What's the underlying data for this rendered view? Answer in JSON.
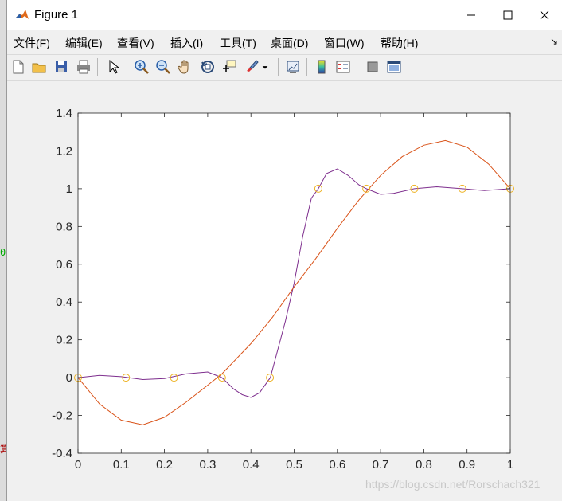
{
  "window": {
    "title": "Figure 1",
    "controls": {
      "minimize": "—",
      "maximize": "☐",
      "close": "✕"
    }
  },
  "menu": {
    "items": [
      "文件(F)",
      "编辑(E)",
      "查看(V)",
      "插入(I)",
      "工具(T)",
      "桌面(D)",
      "窗口(W)",
      "帮助(H)"
    ],
    "dock_glyph": "↘"
  },
  "toolbar": {
    "buttons": [
      "new-figure-icon",
      "open-file-icon",
      "save-icon",
      "print-icon",
      "select-arrow-icon",
      "zoom-in-icon",
      "zoom-out-icon",
      "pan-hand-icon",
      "rotate-3d-icon",
      "data-cursor-icon",
      "brush-icon",
      "brush-dropdown-icon",
      "link-plot-icon",
      "colorbar-icon",
      "legend-icon",
      "hide-plot-tools-icon",
      "show-plot-tools-icon"
    ]
  },
  "watermark": "https://blog.csdn.net/Rorschach321",
  "colors": {
    "purple": "#7e2f8e",
    "orange": "#d95319",
    "markers": "#edb120"
  },
  "chart_data": {
    "type": "line",
    "title": "",
    "xlabel": "",
    "ylabel": "",
    "xlim": [
      0,
      1
    ],
    "ylim": [
      -0.4,
      1.4
    ],
    "xticks": [
      "0",
      "0.1",
      "0.2",
      "0.3",
      "0.4",
      "0.5",
      "0.6",
      "0.7",
      "0.8",
      "0.9",
      "1"
    ],
    "yticks": [
      "-0.4",
      "-0.2",
      "0",
      "0.2",
      "0.4",
      "0.6",
      "0.8",
      "1",
      "1.2",
      "1.4"
    ],
    "grid": false,
    "legend": "none",
    "series": [
      {
        "style": "line",
        "color": "#7e2f8e",
        "x": [
          0,
          0.05,
          0.1,
          0.15,
          0.2,
          0.25,
          0.3,
          0.333,
          0.36,
          0.38,
          0.4,
          0.42,
          0.445,
          0.48,
          0.5,
          0.52,
          0.54,
          0.556,
          0.575,
          0.6,
          0.625,
          0.65,
          0.667,
          0.7,
          0.73,
          0.778,
          0.83,
          0.889,
          0.94,
          1
        ],
        "y": [
          0,
          0.012,
          0.005,
          -0.01,
          -0.005,
          0.02,
          0.03,
          0,
          -0.06,
          -0.09,
          -0.105,
          -0.08,
          0,
          0.3,
          0.5,
          0.75,
          0.95,
          1,
          1.08,
          1.105,
          1.07,
          1.02,
          1,
          0.97,
          0.975,
          1,
          1.01,
          1,
          0.99,
          1
        ]
      },
      {
        "style": "line",
        "color": "#d95319",
        "x": [
          0,
          0.05,
          0.1,
          0.15,
          0.2,
          0.25,
          0.3,
          0.333,
          0.4,
          0.45,
          0.5,
          0.55,
          0.6,
          0.65,
          0.7,
          0.75,
          0.8,
          0.85,
          0.9,
          0.95,
          1
        ],
        "y": [
          0,
          -0.14,
          -0.225,
          -0.25,
          -0.21,
          -0.13,
          -0.04,
          0.02,
          0.18,
          0.32,
          0.48,
          0.63,
          0.79,
          0.94,
          1.07,
          1.17,
          1.23,
          1.255,
          1.22,
          1.13,
          1
        ]
      },
      {
        "style": "markers",
        "color": "#edb120",
        "x": [
          0,
          0.111,
          0.222,
          0.333,
          0.444,
          0.556,
          0.667,
          0.778,
          0.889,
          1
        ],
        "y": [
          0,
          0,
          0,
          0,
          0,
          1,
          1,
          1,
          1,
          1
        ]
      }
    ]
  }
}
